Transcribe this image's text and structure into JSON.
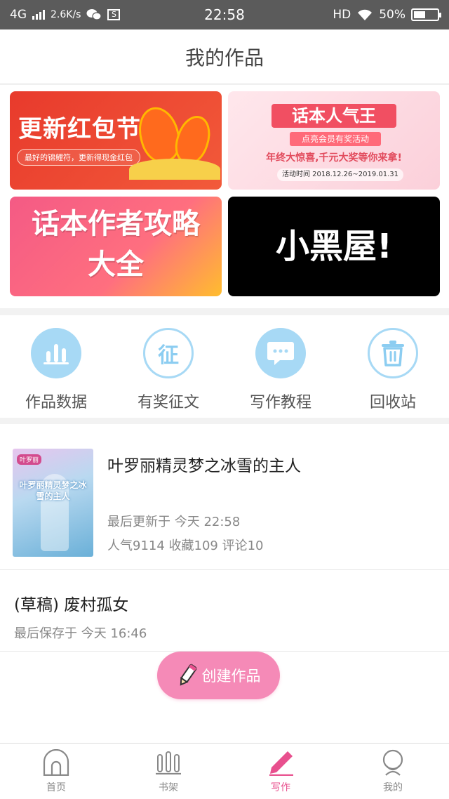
{
  "status_bar": {
    "network": "4G",
    "speed": "2.6K/s",
    "time": "22:58",
    "hd": "HD",
    "battery": "50%",
    "battery_level": 0.5
  },
  "header": {
    "title": "我的作品"
  },
  "banners": [
    {
      "title": "更新红包节",
      "subtitle": "最好的锦鲤符，更新得现金红包"
    },
    {
      "title": "话本人气王",
      "subtitle": "点亮会员有奖活动",
      "line3": "年终大惊喜,千元大奖等你来拿!",
      "line4": "活动时间 2018.12.26~2019.01.31"
    },
    {
      "title_line1": "话本作者攻略",
      "title_line2": "大全"
    },
    {
      "title": "小黑屋!"
    }
  ],
  "tools": [
    {
      "label": "作品数据",
      "icon": "bar-chart-icon"
    },
    {
      "label": "有奖征文",
      "icon": "zheng-icon",
      "glyph": "征"
    },
    {
      "label": "写作教程",
      "icon": "chat-bubble-icon"
    },
    {
      "label": "回收站",
      "icon": "trash-icon"
    }
  ],
  "works": {
    "published": {
      "title": "叶罗丽精灵梦之冰雪的主人",
      "cover_logo": "叶罗丽",
      "cover_text": "叶罗丽精灵梦之冰雪的主人",
      "last_update": "最后更新于 今天 22:58",
      "stats": "人气9114 收藏109 评论10"
    },
    "draft": {
      "title": "(草稿) 废村孤女",
      "last_saved": "最后保存于 今天 16:46"
    },
    "create_label": "创建作品"
  },
  "tabbar": {
    "items": [
      {
        "label": "首页",
        "icon": "home-icon"
      },
      {
        "label": "书架",
        "icon": "bookshelf-icon"
      },
      {
        "label": "写作",
        "icon": "pen-icon",
        "active": true
      },
      {
        "label": "我的",
        "icon": "profile-icon"
      }
    ]
  },
  "colors": {
    "accent": "#e8508e",
    "tool_blue": "#a7d9f5",
    "create_pink": "#f58ab7"
  }
}
